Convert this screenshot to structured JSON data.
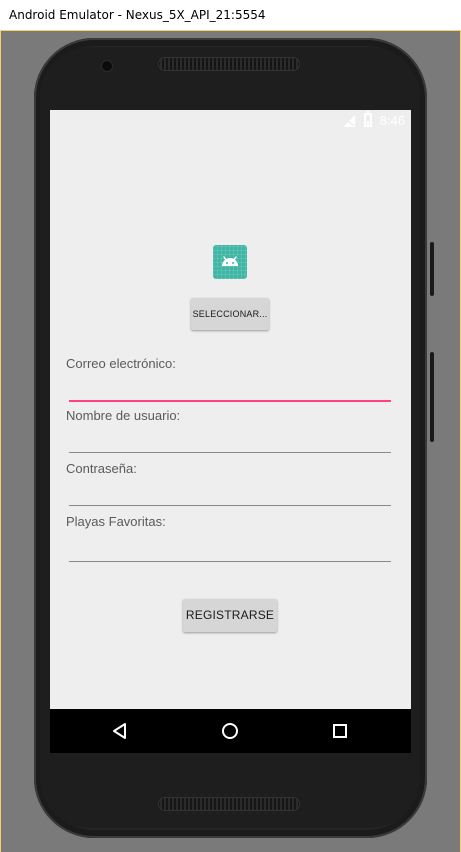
{
  "window": {
    "title": "Android Emulator - Nexus_5X_API_21:5554"
  },
  "status_bar": {
    "time": "8:46"
  },
  "app": {
    "select_button_label": "SELECCIONAR...",
    "fields": [
      {
        "label": "Correo electrónico:",
        "value": ""
      },
      {
        "label": "Nombre de usuario:",
        "value": ""
      },
      {
        "label": "Contraseña:",
        "value": ""
      },
      {
        "label": "Playas Favoritas:",
        "value": ""
      }
    ],
    "register_button_label": "REGISTRARSE",
    "accent_color": "#ff4081",
    "icon_color": "#3fb5a4"
  },
  "nav_bar": {
    "icons": [
      "back-icon",
      "home-icon",
      "recents-icon"
    ]
  }
}
